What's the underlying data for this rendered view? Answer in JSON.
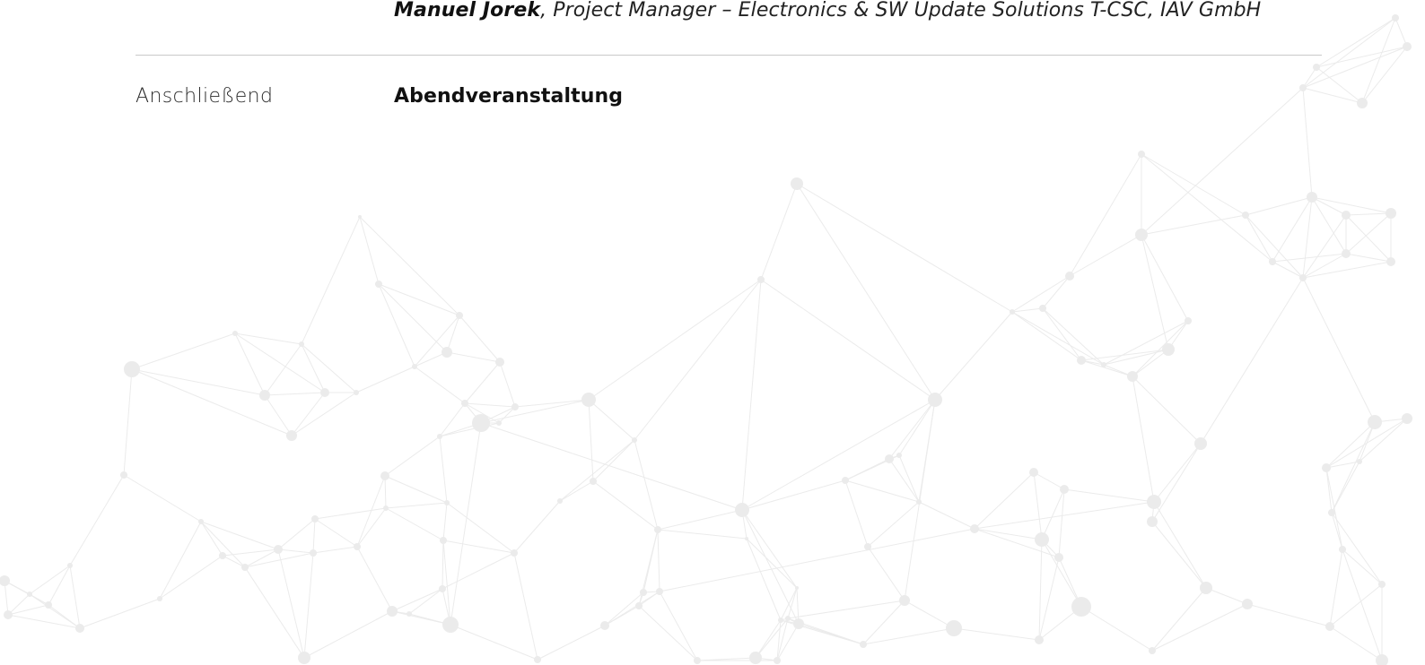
{
  "speaker": {
    "name": "Manuel Jorek",
    "role": ", Project Manager – Electronics & SW Update Solutions T-CSC, IAV GmbH"
  },
  "agenda": [
    {
      "time": "Anschließend",
      "title": "Abendveranstaltung"
    }
  ],
  "colors": {
    "network_line": "#ebebeb",
    "network_node": "#ebebeb",
    "divider": "#c9c9c9",
    "text": "#111111"
  }
}
